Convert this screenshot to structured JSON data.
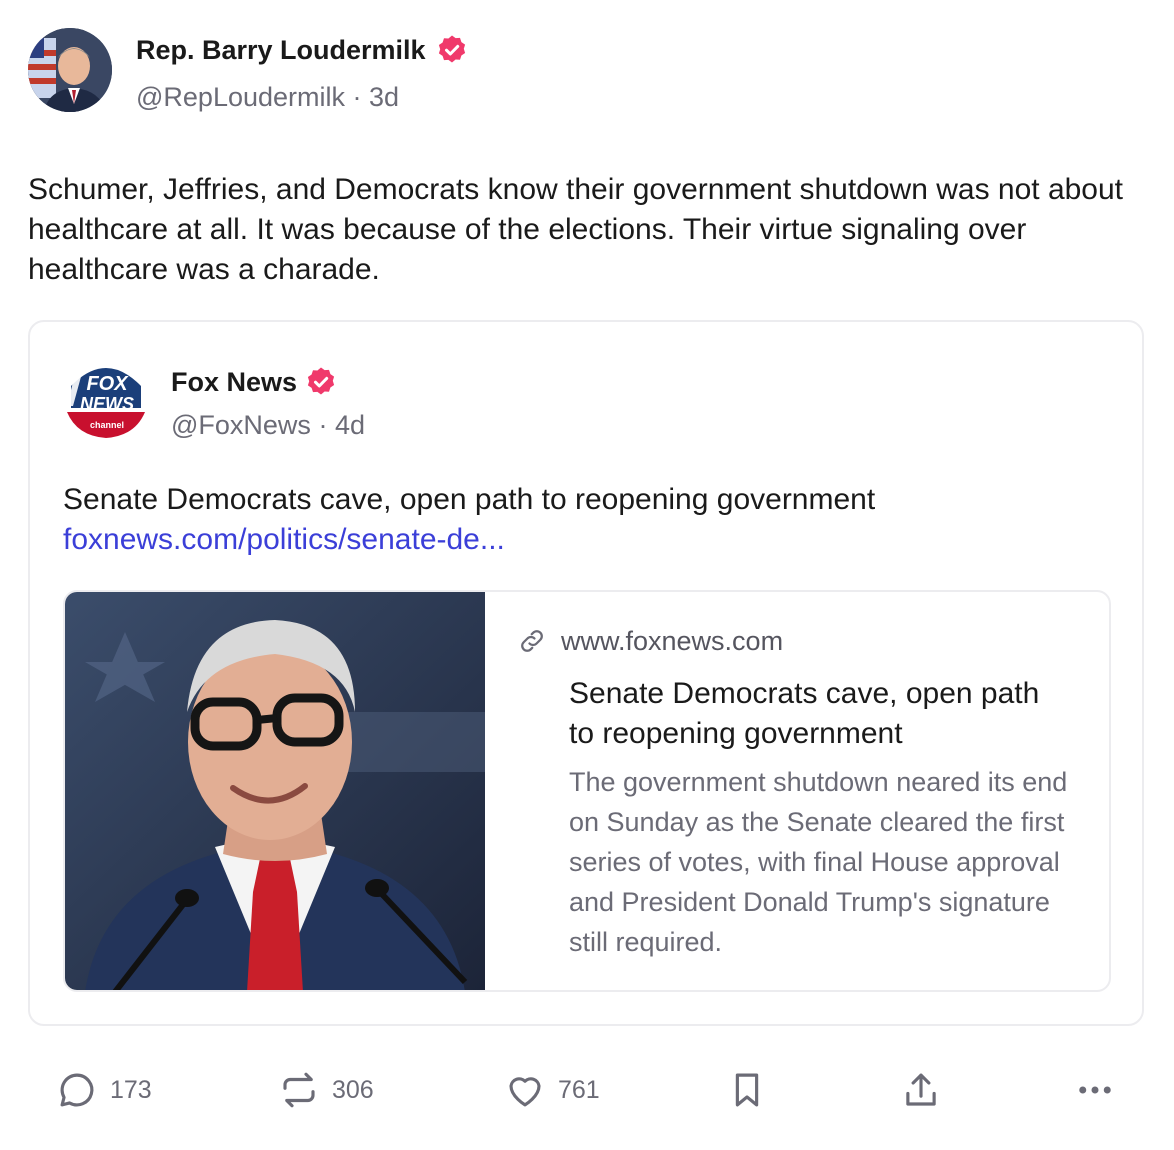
{
  "author": {
    "name": "Rep. Barry Loudermilk",
    "handle": "@RepLoudermilk",
    "time": "3d",
    "verified_color": "#f0396b"
  },
  "post": {
    "text": "Schumer, Jeffries, and Democrats know their government shutdown was not about healthcare at all. It was because of the elections. Their virtue signaling over healthcare was a charade."
  },
  "quote": {
    "name": "Fox News",
    "handle": "@FoxNews",
    "time": "4d",
    "text": "Senate Democrats cave, open path to reopening government",
    "link_text": "foxnews.com/politics/senate-de...",
    "logo_text": "FOX NEWS",
    "logo_subtext": "channel",
    "preview": {
      "domain": "www.foxnews.com",
      "title": "Senate Democrats cave, open path to reopening government",
      "description": "The government shutdown neared its end on Sunday as the Senate cleared the first series of votes, with final House approval and President Donald Trump's signature still required."
    }
  },
  "actions": {
    "replies": "173",
    "reposts": "306",
    "likes": "761"
  },
  "icons": {
    "reply": "speech-bubble-icon",
    "repost": "repost-arrows-icon",
    "like": "heart-icon",
    "bookmark": "bookmark-icon",
    "share": "share-upload-icon",
    "more": "ellipsis-icon",
    "verified": "verified-badge-icon",
    "link": "link-chain-icon"
  },
  "colors": {
    "link": "#3b3fd8",
    "muted_text": "#6b6b76",
    "border": "#ececef"
  }
}
